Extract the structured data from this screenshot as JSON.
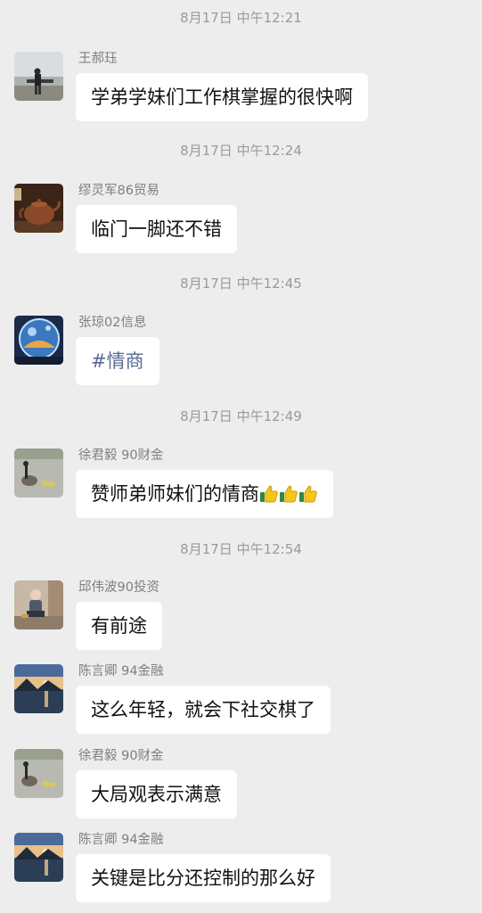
{
  "messages": [
    {
      "time": "8月17日 中午12:21",
      "sender": "王郝珏",
      "text": "学弟学妹们工作棋掌握的很快啊",
      "avatar": "person-by-lake-avatar"
    },
    {
      "time": "8月17日 中午12:24",
      "sender": "缪灵军86贸易",
      "text": "临门一脚还不错",
      "avatar": "teapot-avatar"
    },
    {
      "time": "8月17日 中午12:45",
      "sender": "张琼02信息",
      "text": "#情商",
      "avatar": "crystal-globe-avatar"
    },
    {
      "time": "8月17日 中午12:49",
      "sender": "徐君毅 90财金",
      "text": "赞师弟师妹们的情商",
      "emoji_count": 3,
      "emoji": "thumbs-up",
      "avatar": "goose-avatar"
    },
    {
      "time": "8月17日 中午12:54",
      "sender": "邱伟波90投资",
      "text": "有前途",
      "avatar": "child-avatar"
    },
    {
      "sender": "陈言卿  94金融",
      "text": "这么年轻，就会下社交棋了",
      "avatar": "sunset-lake-avatar"
    },
    {
      "sender": "徐君毅 90财金",
      "text": "大局观表示满意",
      "avatar": "goose-avatar"
    },
    {
      "sender": "陈言卿  94金融",
      "text": "关键是比分还控制的那么好",
      "avatar": "sunset-lake-avatar"
    }
  ]
}
